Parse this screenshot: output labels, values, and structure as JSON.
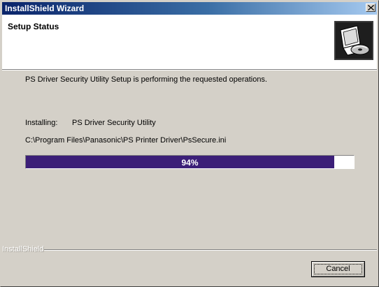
{
  "window": {
    "title": "InstallShield Wizard",
    "close_icon": "close-icon"
  },
  "header": {
    "title": "Setup Status",
    "icon": "computer-install-icon"
  },
  "body": {
    "status_message": "PS Driver Security Utility Setup is performing the requested operations.",
    "installing_label": "Installing:",
    "installing_value": "PS Driver Security Utility",
    "file_path": "C:\\Program Files\\Panasonic\\PS Printer Driver\\PsSecure.ini"
  },
  "progress": {
    "percent": 94,
    "label": "94%",
    "fill_color": "#3c1f78"
  },
  "footer": {
    "brand": "InstallShield",
    "cancel_label": "Cancel"
  },
  "colors": {
    "titlebar_start": "#0a246a",
    "titlebar_end": "#a6caf0",
    "face": "#d4d0c8"
  }
}
